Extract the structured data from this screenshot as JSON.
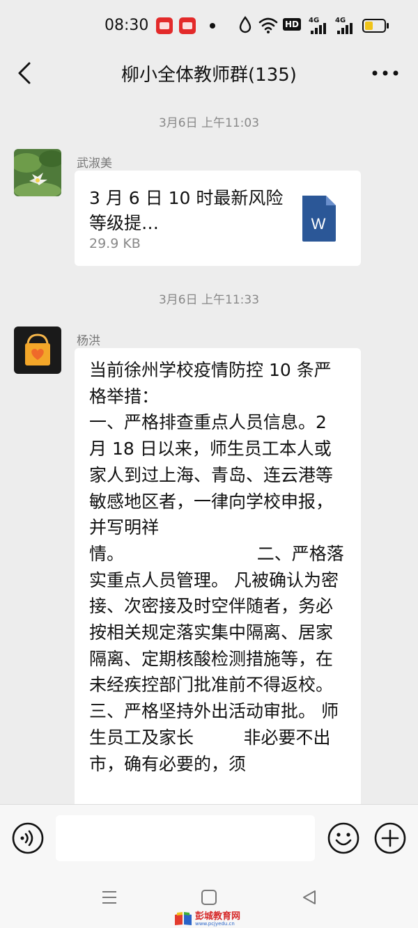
{
  "status_bar": {
    "time": "08:30",
    "hd_label": "HD",
    "net1": "4G",
    "net2": "4G",
    "icons": [
      "app-icon",
      "app-icon",
      "dot-icon",
      "water-drop-icon",
      "wifi-icon",
      "hd-icon",
      "signal-icon",
      "signal-icon",
      "battery-icon"
    ]
  },
  "header": {
    "title": "柳小全体教师群(135)",
    "back_icon": "chevron-left-icon",
    "more_icon": "more-icon"
  },
  "messages": [
    {
      "timestamp": "3月6日 上午11:03",
      "sender": "武淑美",
      "type": "file",
      "file_name": "3 月 6 日 10 时最新风险等级提…",
      "file_size": "29.9 KB",
      "file_icon": "word-document-icon",
      "file_icon_letter": "W"
    },
    {
      "timestamp": "3月6日 上午11:33",
      "sender": "杨洪",
      "type": "text",
      "text": "当前徐州学校疫情防控 10 条严格举措：\n一、严格排查重点人员信息。2 月 18 日以来，师生员工本人或家人到过上海、青岛、连云港等敏感地区者，一律向学校申报，并写明祥\n情。                        二、严格落实重点人员管理。 凡被确认为密接、次密接及时空伴随者，务必按相关规定落实集中隔离、居家隔离、定期核酸检测措施等，在未经疾控部门批准前不得返校。\n三、严格坚持外出活动审批。 师生员工及家长         非必要不出市，确有必要的，须"
    }
  ],
  "input_bar": {
    "voice_icon": "voice-icon",
    "emoji_icon": "emoji-icon",
    "plus_icon": "plus-icon",
    "input_value": ""
  },
  "nav_bar": {
    "icons": [
      "menu-icon",
      "home-icon",
      "back-triangle-icon"
    ]
  },
  "watermark": {
    "text": "彭城教育网",
    "sub": "www.pcjyedu.cn"
  },
  "colors": {
    "background": "#ededed",
    "bubble": "#ffffff",
    "word_blue": "#2b5797",
    "battery": "#f0c419",
    "watermark_red": "#d62828"
  }
}
